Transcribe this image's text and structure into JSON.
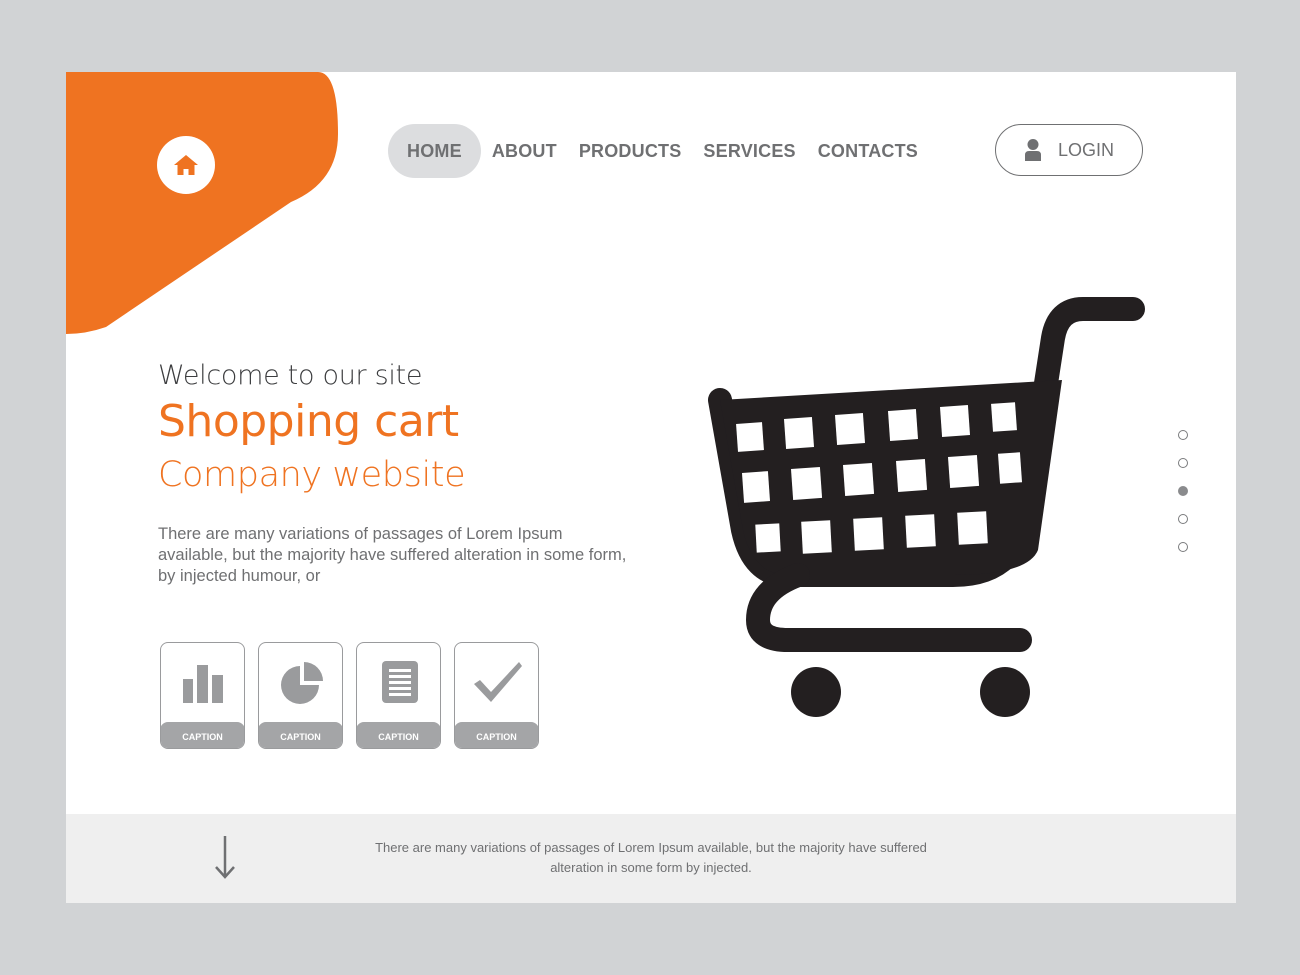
{
  "colors": {
    "accent": "#ef7321",
    "frame": "#d1d3d5",
    "text_gray": "#6f7072",
    "footer_bg": "#efefef"
  },
  "header": {
    "home_icon": "home-icon",
    "nav": [
      {
        "label": "HOME",
        "active": true
      },
      {
        "label": "ABOUT",
        "active": false
      },
      {
        "label": "PRODUCTS",
        "active": false
      },
      {
        "label": "SERVICES",
        "active": false
      },
      {
        "label": "CONTACTS",
        "active": false
      }
    ],
    "login": {
      "label": "LOGIN",
      "icon": "user-icon"
    }
  },
  "hero": {
    "welcome": "Welcome to our site",
    "title": "Shopping cart",
    "subtitle": "Company website",
    "description": "There are many variations of passages of Lorem Ipsum available, but the majority have suffered alteration in some form, by injected humour, or",
    "illustration": "shopping-cart-icon"
  },
  "cards": [
    {
      "icon": "bar-chart-icon",
      "caption": "CAPTION"
    },
    {
      "icon": "pie-chart-icon",
      "caption": "CAPTION"
    },
    {
      "icon": "document-icon",
      "caption": "CAPTION"
    },
    {
      "icon": "checkmark-icon",
      "caption": "CAPTION"
    }
  ],
  "pager": {
    "count": 5,
    "active_index": 2
  },
  "footer": {
    "arrow_icon": "arrow-down-icon",
    "text": "There are many variations of passages of Lorem Ipsum available, but the majority have suffered alteration in some form by injected."
  }
}
